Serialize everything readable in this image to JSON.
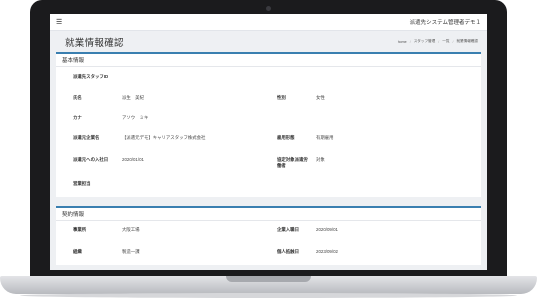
{
  "topbar": {
    "menu_icon": "☰",
    "app_title": "派遣先システム管理者デモ１"
  },
  "header": {
    "page_title": "就業情報確認",
    "breadcrumb": [
      "home",
      "スタッフ管理",
      "一覧",
      "就業情報確認"
    ]
  },
  "basic_info": {
    "title": "基本情報",
    "fields": {
      "staff_id_label": "派遣先スタッフID",
      "staff_id_value": "",
      "name_label": "氏名",
      "name_value": "派生　美紀",
      "gender_label": "性別",
      "gender_value": "女性",
      "kana_label": "カナ",
      "kana_value": "アソウ　ミキ",
      "dispatch_company_label": "派遣元企業名",
      "dispatch_company_value": "【派遣元デモ】キャリアスタッフ株式会社",
      "employment_label": "雇用形態",
      "employment_value": "有期雇用",
      "join_date_label": "派遣元への入社日",
      "join_date_value": "2020/01/01",
      "agreement_label": "協定対象派遣労働者",
      "agreement_value": "対象",
      "business_lead_label": "営業担当",
      "business_lead_value": ""
    }
  },
  "contract_info": {
    "title": "契約情報",
    "fields": {
      "office_label": "事業所",
      "office_value": "大阪工場",
      "company_join_label": "企業入職日",
      "company_join_value": "2020/09/01",
      "dept_label": "組織",
      "dept_value": "製造一課",
      "individual_date_label": "個人抵触日",
      "individual_date_value": "2023/09/02"
    }
  }
}
